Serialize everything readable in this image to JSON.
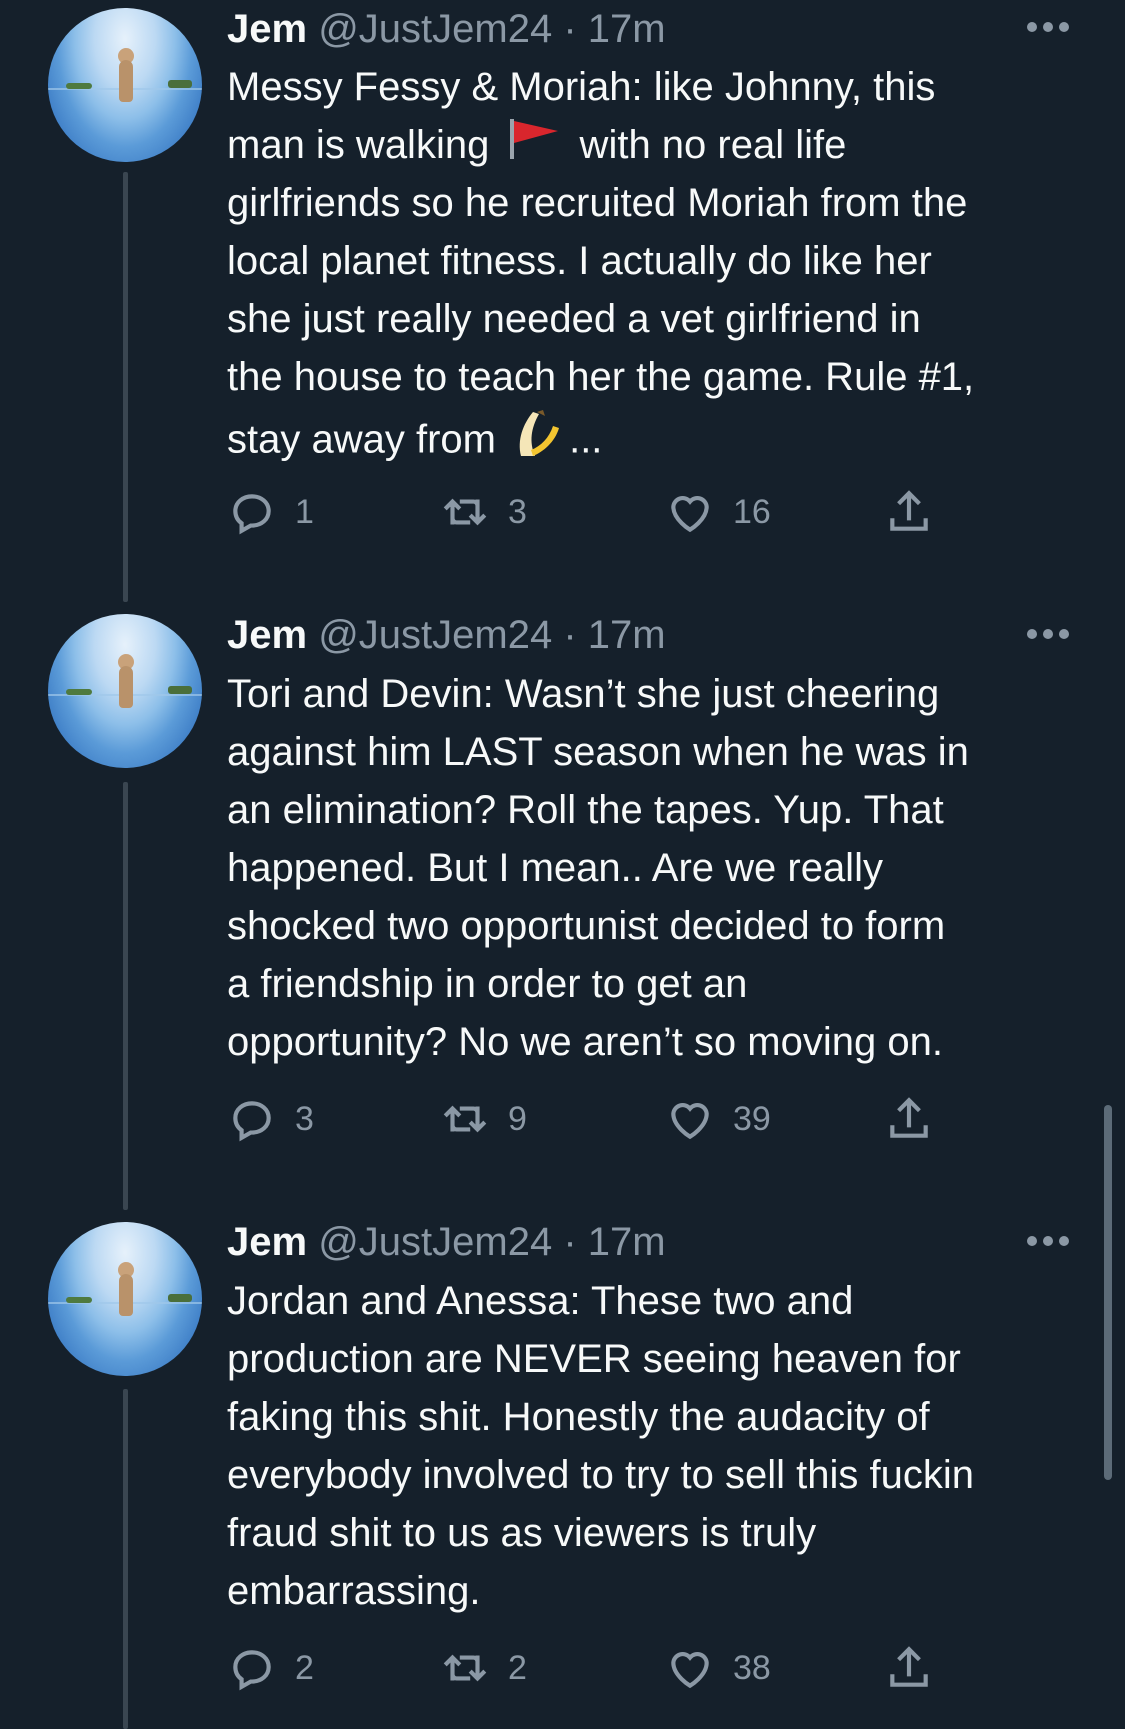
{
  "tweets": [
    {
      "name": "Jem",
      "handle": "@JustJem24",
      "separator": "·",
      "time": "17m",
      "lines": [
        "Messy Fessy & Moriah: like Johnny, this",
        [
          "man is walking ",
          "flag",
          " with no real life"
        ],
        "girlfriends so he recruited Moriah from the",
        "local planet fitness. I actually do like her",
        "she just really needed a vet girlfriend in",
        "the house to teach her the game. Rule #1,",
        [
          "stay away from ",
          "banana",
          "..."
        ]
      ],
      "replies": "1",
      "retweets": "3",
      "likes": "16"
    },
    {
      "name": "Jem",
      "handle": "@JustJem24",
      "separator": "·",
      "time": "17m",
      "lines": [
        "Tori and Devin: Wasn’t she just cheering",
        "against him LAST season when he was in",
        "an elimination? Roll the tapes. Yup. That",
        "happened. But I mean.. Are we really",
        "shocked two opportunist decided to form",
        "a friendship in order to get an",
        "opportunity? No we aren’t so moving on."
      ],
      "replies": "3",
      "retweets": "9",
      "likes": "39"
    },
    {
      "name": "Jem",
      "handle": "@JustJem24",
      "separator": "·",
      "time": "17m",
      "lines": [
        "Jordan and Anessa: These two and",
        "production are NEVER seeing heaven for",
        "faking this shit. Honestly the audacity of",
        "everybody involved to try to sell this fuckin",
        "fraud shit to us as viewers is truly",
        "embarrassing."
      ],
      "replies": "2",
      "retweets": "2",
      "likes": "38"
    }
  ],
  "icons": {
    "reply": "reply-icon",
    "retweet": "retweet-icon",
    "like": "heart-icon",
    "share": "share-icon",
    "more": "more-icon",
    "flag_emoji": "red-flag-emoji",
    "banana_emoji": "banana-emoji"
  },
  "colors": {
    "background": "#15202b",
    "text": "#f7f9f9",
    "secondary": "#8b98a5"
  }
}
